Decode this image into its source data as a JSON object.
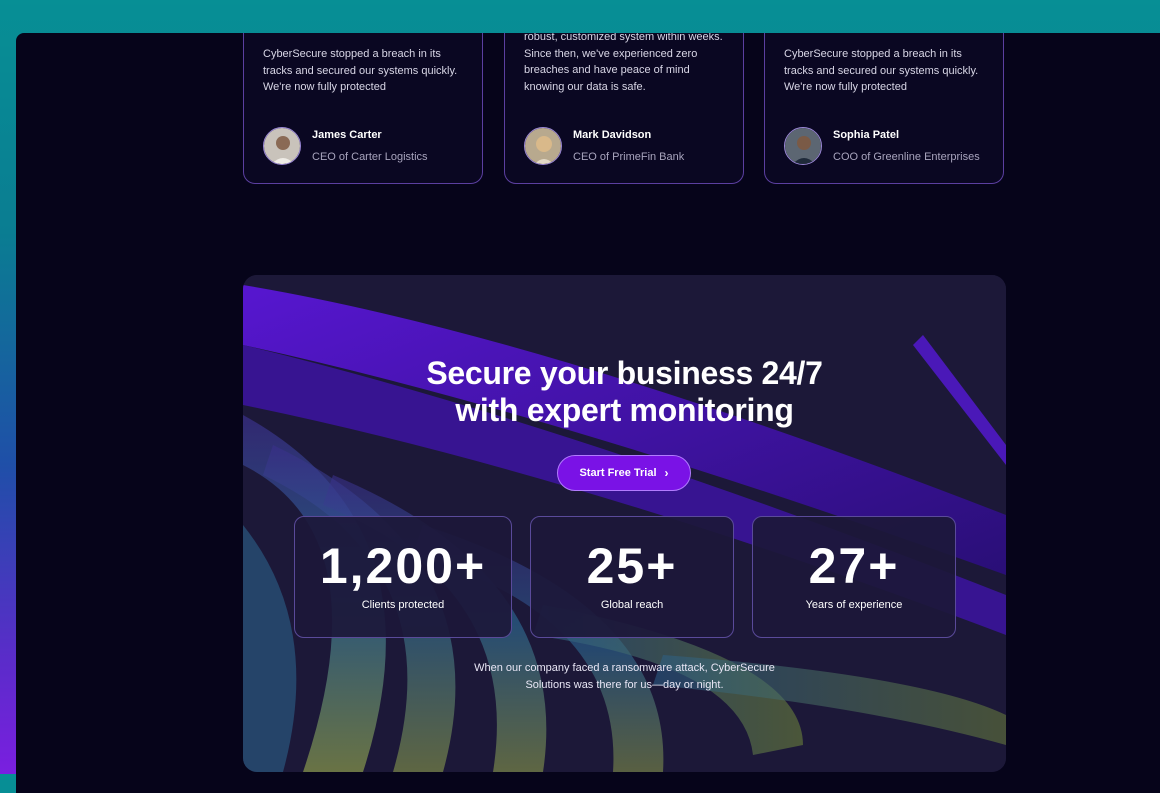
{
  "testimonials": [
    {
      "quote": "CyberSecure stopped a breach in its tracks and secured our systems quickly. We're now fully protected",
      "name": "James Carter",
      "role": "CEO of Carter Logistics"
    },
    {
      "quote": "robust, customized system within weeks. Since then, we've experienced zero breaches and have peace of mind knowing our data is safe.",
      "name": "Mark Davidson",
      "role": "CEO of PrimeFin Bank"
    },
    {
      "quote": "CyberSecure stopped a breach in its tracks and secured our systems quickly. We're now fully protected",
      "name": "Sophia Patel",
      "role": "COO of Greenline Enterprises"
    }
  ],
  "cta": {
    "headline_line1": "Secure your business 24/7",
    "headline_line2": "with expert monitoring",
    "button_label": "Start Free Trial",
    "button_icon": "chevron-right-icon"
  },
  "stats": [
    {
      "value": "1,200+",
      "label": "Clients protected"
    },
    {
      "value": "25+",
      "label": "Global reach"
    },
    {
      "value": "27+",
      "label": "Years of experience"
    }
  ],
  "testimonial_line1": "When our company faced a ransomware attack, CyberSecure",
  "testimonial_line2": "Solutions was there for us—day or night.",
  "colors": {
    "accent": "#7a12e6",
    "background": "#06041a",
    "card_border": "#5b3fa0"
  }
}
